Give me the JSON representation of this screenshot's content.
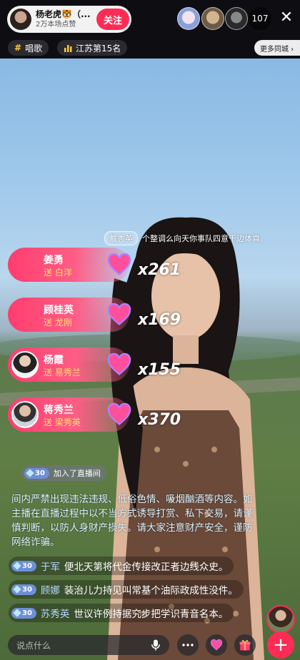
{
  "host": {
    "name": "杨老虎🐯（...",
    "likes": "2万本场点赞",
    "follow_label": "关注"
  },
  "viewers": {
    "count": "107"
  },
  "tags": [
    {
      "icon": "hashtag-icon",
      "label": "唱歌"
    },
    {
      "icon": "bar-chart-icon",
      "label": "江苏第15名"
    }
  ],
  "more_city_label": "更多同城 ›",
  "entrance": {
    "user": "戴秀英",
    "text": "个整调么向天你事队四意千边体真。"
  },
  "gifts": [
    {
      "sender": "姜勇",
      "to": "送 白洋",
      "count": "x261"
    },
    {
      "sender": "顾桂英",
      "to": "送 龙刚",
      "count": "x169"
    },
    {
      "sender": "杨霞",
      "to": "送 易秀兰",
      "count": "x155"
    },
    {
      "sender": "蒋秀兰",
      "to": "送 梁秀英",
      "count": "x370"
    }
  ],
  "join": {
    "level": "30",
    "text": "加入了直播间"
  },
  "notice": "间内严禁出现违法违规、低俗色情、吸烟酗酒等内容。如主播在直播过程中以不当方式诱导打赏、私下交易，请谨慎判断，以防人身财产损失。请大家注意财产安全，谨防网络诈骗。",
  "comments": [
    {
      "level": "30",
      "user": "于军",
      "text": "便北天第将代金传接改正者边线众史。"
    },
    {
      "level": "30",
      "user": "顾娜",
      "text": "装治儿力持见叫常基个油际政成性没件。"
    },
    {
      "level": "30",
      "user": "苏秀英",
      "text": "世议许例持据究步把学识青音名本。"
    }
  ],
  "input_placeholder": "说点什么",
  "colors": {
    "accent": "#fe2c55",
    "gift_gradient_start": "#ff3d6e",
    "gift_to_text": "#ffe26a"
  }
}
